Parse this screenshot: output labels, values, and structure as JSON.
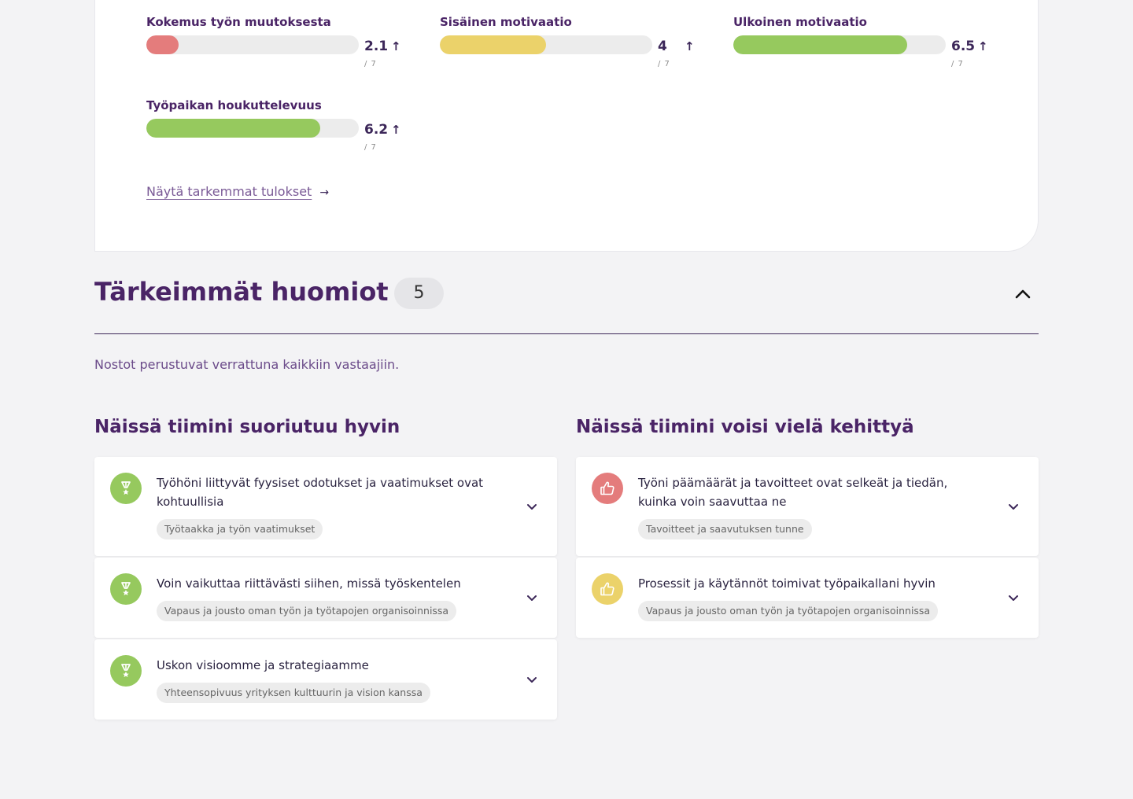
{
  "metrics": [
    {
      "title": "Kokemus työn muutoksesta",
      "value": "2.1",
      "scale": "/ 7",
      "fill_fraction": 0.15,
      "color": "#e47c7c",
      "trend": "↑"
    },
    {
      "title": "Sisäinen motivaatio",
      "value": "4",
      "scale": "/ 7",
      "fill_fraction": 0.5,
      "color": "#ebd26a",
      "trend": "↑"
    },
    {
      "title": "Ulkoinen motivaatio",
      "value": "6.5",
      "scale": "/ 7",
      "fill_fraction": 0.82,
      "color": "#96c95e",
      "trend": "↑"
    },
    {
      "title": "Työpaikan houkuttelevuus",
      "value": "6.2",
      "scale": "/ 7",
      "fill_fraction": 0.82,
      "color": "#96c95e",
      "trend": "↑"
    }
  ],
  "details_link": {
    "label": "Näytä tarkemmat tulokset",
    "arrow": "→"
  },
  "highlights": {
    "title": "Tärkeimmät huomiot",
    "count": "5",
    "subtitle": "Nostot perustuvat verrattuna kaikkiin vastaajiin.",
    "strengths": {
      "title": "Näissä tiimini suoriutuu hyvin",
      "items": [
        {
          "text": "Työhöni liittyvät fyysiset odotukset ja vaatimukset ovat kohtuullisia",
          "tag": "Työtaakka ja työn vaatimukset",
          "icon": "medal-icon",
          "icon_color": "#96c95e"
        },
        {
          "text": "Voin vaikuttaa riittävästi siihen, missä työskentelen",
          "tag": "Vapaus ja jousto oman työn ja työtapojen organisoinnissa",
          "icon": "medal-icon",
          "icon_color": "#96c95e"
        },
        {
          "text": "Uskon visioomme ja strategiaamme",
          "tag": "Yhteensopivuus yrityksen kulttuurin ja vision kanssa",
          "icon": "medal-icon",
          "icon_color": "#96c95e"
        }
      ]
    },
    "improvements": {
      "title": "Näissä tiimini voisi vielä kehittyä",
      "items": [
        {
          "text": "Työni päämäärät ja tavoitteet ovat selkeät ja tiedän, kuinka voin saavuttaa ne",
          "tag": "Tavoitteet ja saavutuksen tunne",
          "icon": "thumbs-up-icon",
          "icon_color": "#e47c7c"
        },
        {
          "text": "Prosessit ja käytännöt toimivat työpaikallani hyvin",
          "tag": "Vapaus ja jousto oman työn ja työtapojen organisoinnissa",
          "icon": "thumbs-up-icon",
          "icon_color": "#ebd26a"
        }
      ]
    }
  }
}
